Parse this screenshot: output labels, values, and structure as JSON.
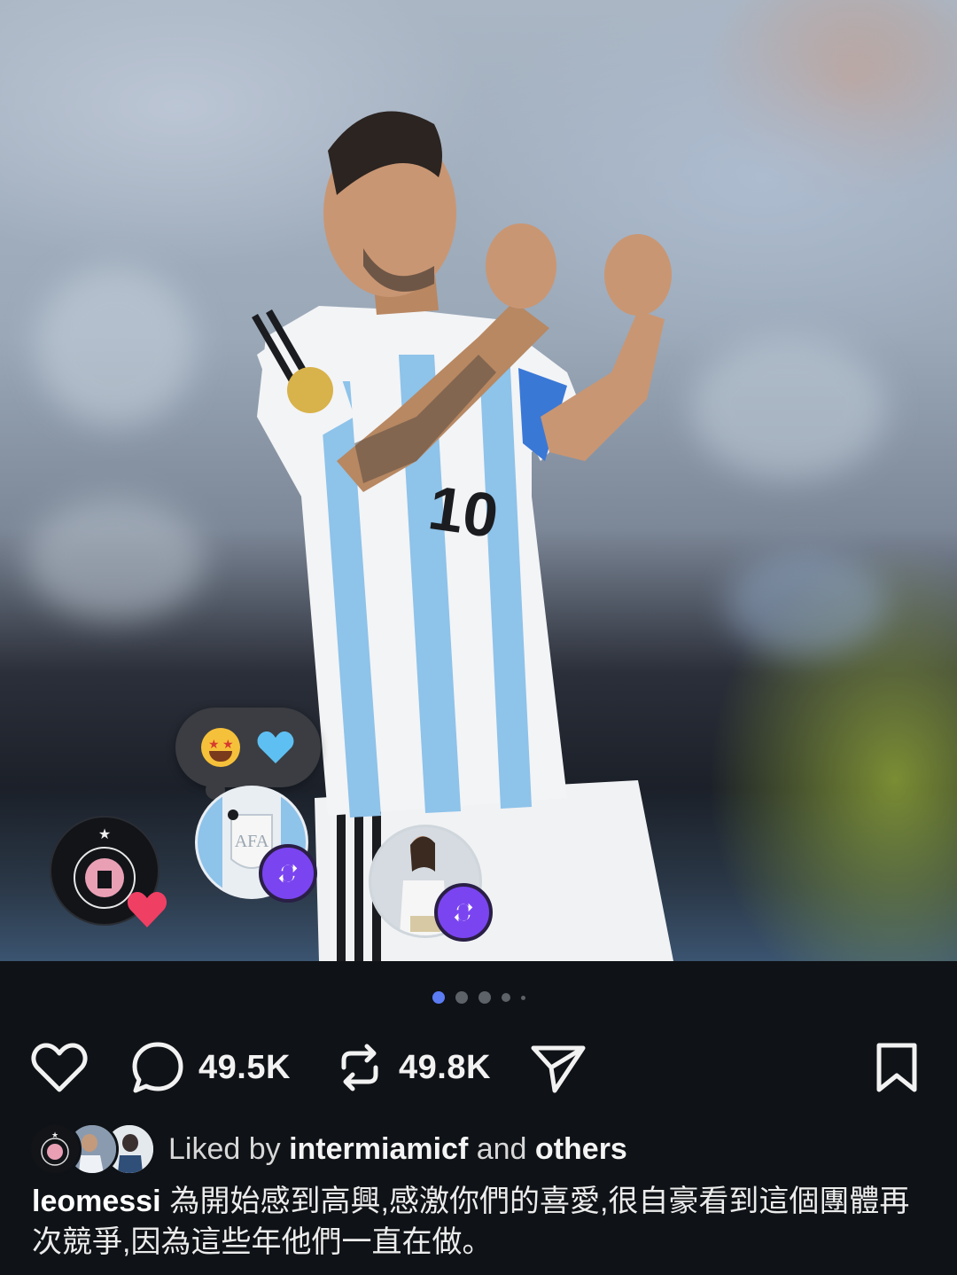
{
  "post": {
    "reactions": {
      "emojis": [
        "star-struck-emoji",
        "blue-heart-emoji"
      ]
    },
    "carousel": {
      "count": 5,
      "active_index": 0
    },
    "actions": {
      "like_icon": "heart-outline-icon",
      "comment_icon": "comment-bubble-icon",
      "comment_count": "49.5K",
      "repost_icon": "repost-icon",
      "repost_count": "49.8K",
      "share_icon": "send-paper-plane-icon",
      "bookmark_icon": "bookmark-icon"
    },
    "likes": {
      "prefix": "Liked by",
      "user": "intermiamicf",
      "connector": "and",
      "suffix": "others"
    },
    "caption": {
      "username": "leomessi",
      "text": "為開始感到高興,感激你們的喜愛,很自豪看到這個團體再次競爭,因為這些年他們一直在做。"
    }
  },
  "colors": {
    "background": "#0f1216",
    "active_dot": "#5b7cf3",
    "repost_badge": "#7a45f0",
    "heart_badge": "#ef3f63"
  }
}
